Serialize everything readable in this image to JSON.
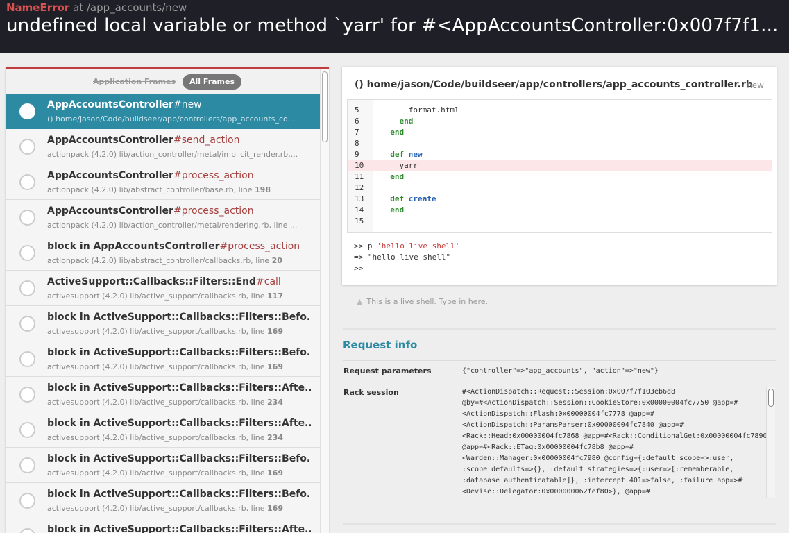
{
  "header": {
    "error_class": "NameError",
    "at_label": "at",
    "path": "/app_accounts/new",
    "message": "undefined local variable or method `yarr' for #<AppAccountsController:0x007f7f1..."
  },
  "frames_tabs": {
    "application_frames": "Application Frames",
    "all_frames": "All Frames"
  },
  "frames": [
    {
      "context": "AppAccountsController",
      "method": "#new",
      "location": "() home/jason/Code/buildseer/app/controllers/app_accounts_co...",
      "line": ""
    },
    {
      "context": "AppAccountsController",
      "method": "#send_action",
      "location": "actionpack (4.2.0) lib/action_controller/metal/implicit_render.rb,...",
      "line": ""
    },
    {
      "context": "AppAccountsController",
      "method": "#process_action",
      "location": "actionpack (4.2.0) lib/abstract_controller/base.rb, line ",
      "line": "198"
    },
    {
      "context": "AppAccountsController",
      "method": "#process_action",
      "location": "actionpack (4.2.0) lib/action_controller/metal/rendering.rb, line ...",
      "line": ""
    },
    {
      "context": "block in AppAccountsController",
      "method": "#process_action",
      "location": "actionpack (4.2.0) lib/abstract_controller/callbacks.rb, line ",
      "line": "20"
    },
    {
      "context": "ActiveSupport::Callbacks::Filters::End",
      "method": "#call",
      "location": "activesupport (4.2.0) lib/active_support/callbacks.rb, line ",
      "line": "117"
    },
    {
      "context": "block in ActiveSupport::Callbacks::Filters::Befo...",
      "method": "",
      "location": "activesupport (4.2.0) lib/active_support/callbacks.rb, line ",
      "line": "169"
    },
    {
      "context": "block in ActiveSupport::Callbacks::Filters::Befo...",
      "method": "",
      "location": "activesupport (4.2.0) lib/active_support/callbacks.rb, line ",
      "line": "169"
    },
    {
      "context": "block in ActiveSupport::Callbacks::Filters::Afte...",
      "method": "",
      "location": "activesupport (4.2.0) lib/active_support/callbacks.rb, line ",
      "line": "234"
    },
    {
      "context": "block in ActiveSupport::Callbacks::Filters::Afte...",
      "method": "",
      "location": "activesupport (4.2.0) lib/active_support/callbacks.rb, line ",
      "line": "234"
    },
    {
      "context": "block in ActiveSupport::Callbacks::Filters::Befo...",
      "method": "",
      "location": "activesupport (4.2.0) lib/active_support/callbacks.rb, line ",
      "line": "169"
    },
    {
      "context": "block in ActiveSupport::Callbacks::Filters::Befo...",
      "method": "",
      "location": "activesupport (4.2.0) lib/active_support/callbacks.rb, line ",
      "line": "169"
    },
    {
      "context": "block in ActiveSupport::Callbacks::Filters::Afte...",
      "method": "",
      "location": "",
      "line": ""
    }
  ],
  "code": {
    "file": "() home/jason/Code/buildseer/app/controllers/app_accounts_controller.rb",
    "method_tag": "new",
    "highlight_line": "10",
    "lines": [
      {
        "num": "5",
        "text": "      format.html",
        "kind": "plain"
      },
      {
        "num": "6",
        "text": "    end",
        "kind": "kw"
      },
      {
        "num": "7",
        "text": "  end",
        "kind": "kw"
      },
      {
        "num": "8",
        "text": "",
        "kind": "plain"
      },
      {
        "num": "9",
        "text": "  def new",
        "kind": "def"
      },
      {
        "num": "10",
        "text": "    yarr",
        "kind": "plain"
      },
      {
        "num": "11",
        "text": "  end",
        "kind": "kw"
      },
      {
        "num": "12",
        "text": "",
        "kind": "plain"
      },
      {
        "num": "13",
        "text": "  def create",
        "kind": "def"
      },
      {
        "num": "14",
        "text": "  end",
        "kind": "kw"
      },
      {
        "num": "15",
        "text": "",
        "kind": "plain"
      }
    ]
  },
  "console": {
    "cmd_prompt": ">> p ",
    "cmd_string": "'hello live shell'",
    "result": "=> \"hello live shell\"",
    "prompt": ">> "
  },
  "shell_hint": "This is a live shell. Type in here.",
  "request_info": {
    "title": "Request info",
    "params_label": "Request parameters",
    "params_value": "{\"controller\"=>\"app_accounts\", \"action\"=>\"new\"}",
    "rack_label": "Rack session",
    "rack_lines": [
      "#<ActionDispatch::Request::Session:0x007f7f103eb6d8",
      "@by=#<ActionDispatch::Session::CookieStore:0x00000004fc7750 @app=#",
      "<ActionDispatch::Flash:0x00000004fc7778 @app=#",
      "<ActionDispatch::ParamsParser:0x00000004fc7840 @app=#",
      "<Rack::Head:0x00000004fc7868 @app=#<Rack::ConditionalGet:0x00000004fc7890",
      "@app=#<Rack::ETag:0x00000004fc78b8 @app=#",
      "<Warden::Manager:0x00000004fc7980 @config={:default_scope=>:user,",
      ":scope_defaults=>{}, :default_strategies=>{:user=>[:rememberable,",
      ":database_authenticatable]}, :intercept_401=>false, :failure_app=>#",
      "<Devise::Delegator:0x000000062fef80>}, @app=#"
    ]
  }
}
